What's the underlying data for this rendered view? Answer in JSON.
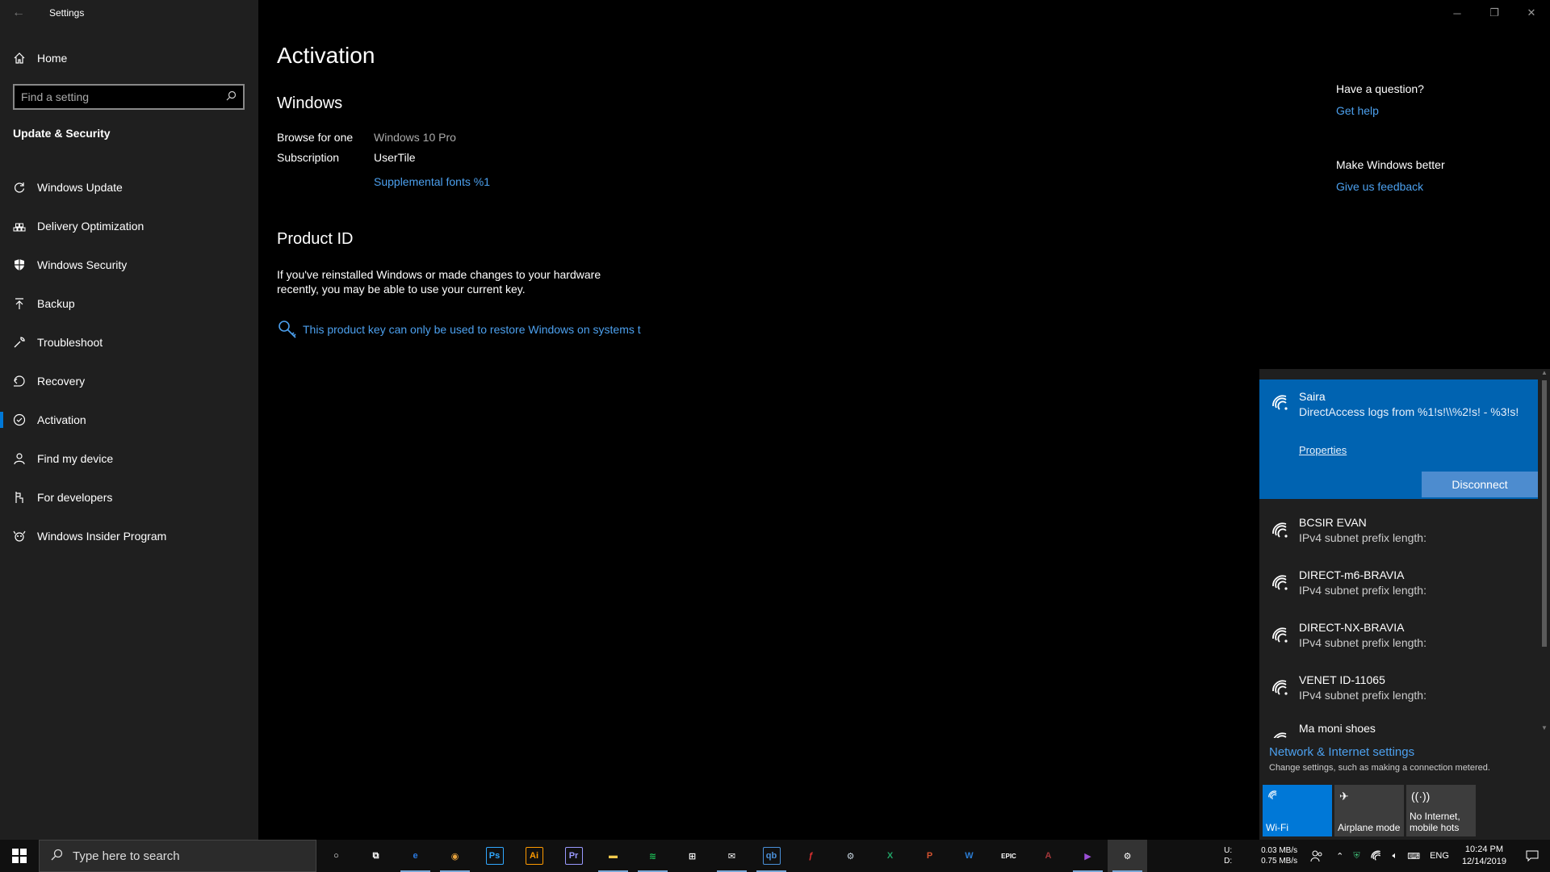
{
  "window": {
    "title": "Settings",
    "controls": {
      "minimize": "─",
      "restore": "❐",
      "close": "✕"
    }
  },
  "sidebar": {
    "home": "Home",
    "search_placeholder": "Find a setting",
    "section": "Update & Security",
    "items": [
      {
        "label": "Windows Update",
        "icon": "refresh-icon"
      },
      {
        "label": "Delivery Optimization",
        "icon": "delivery-icon"
      },
      {
        "label": "Windows Security",
        "icon": "shield-icon"
      },
      {
        "label": "Backup",
        "icon": "backup-icon"
      },
      {
        "label": "Troubleshoot",
        "icon": "wrench-icon"
      },
      {
        "label": "Recovery",
        "icon": "recovery-icon"
      },
      {
        "label": "Activation",
        "icon": "check-circle-icon",
        "active": true
      },
      {
        "label": "Find my device",
        "icon": "person-pin-icon"
      },
      {
        "label": "For developers",
        "icon": "developer-icon"
      },
      {
        "label": "Windows Insider Program",
        "icon": "insider-icon"
      }
    ]
  },
  "main": {
    "title": "Activation",
    "windows_heading": "Windows",
    "edition_label": "Browse for one",
    "edition_value": "Windows 10 Pro",
    "subscription_label": "Subscription",
    "subscription_value": "UserTile",
    "supplemental_link": "Supplemental fonts %1",
    "product_id_heading": "Product ID",
    "product_id_text": "If you've reinstalled Windows or made changes to your hardware recently, you may be able to use your current key.",
    "key_link": "This product key can only be used to restore Windows on systems t"
  },
  "help_panel": {
    "question_heading": "Have a question?",
    "get_help": "Get help",
    "better_heading": "Make Windows better",
    "feedback": "Give us feedback"
  },
  "network_flyout": {
    "connected": {
      "name": "Saira",
      "status": "DirectAccess logs from %1!s!\\\\%2!s! - %3!s!",
      "properties": "Properties",
      "disconnect": "Disconnect"
    },
    "networks": [
      {
        "name": "BCSIR EVAN",
        "status": "IPv4 subnet prefix length:"
      },
      {
        "name": "DIRECT-m6-BRAVIA",
        "status": "IPv4 subnet prefix length:"
      },
      {
        "name": "DIRECT-NX-BRAVIA",
        "status": "IPv4 subnet prefix length:"
      },
      {
        "name": "VENET ID-11065",
        "status": "IPv4 subnet prefix length:"
      },
      {
        "name": "Ma moni shoes",
        "status": ""
      }
    ],
    "settings_link": "Network & Internet settings",
    "settings_sub": "Change settings, such as making a connection metered.",
    "tiles": [
      {
        "label": "Wi-Fi",
        "icon": "wifi-icon",
        "on": true
      },
      {
        "label": "Airplane mode",
        "icon": "airplane-icon",
        "on": false
      },
      {
        "label": "No Internet, mobile hots",
        "icon": "hotspot-icon",
        "on": false
      }
    ]
  },
  "taskbar": {
    "search_placeholder": "Type here to search",
    "apps": [
      {
        "name": "cortana",
        "glyph": "○",
        "color": "#ffffff"
      },
      {
        "name": "task-view",
        "glyph": "⧉",
        "color": "#ffffff"
      },
      {
        "name": "edge",
        "glyph": "e",
        "color": "#2a7ae2"
      },
      {
        "name": "chrome",
        "glyph": "◉",
        "color": "#e8a33d"
      },
      {
        "name": "photoshop",
        "glyph": "Ps",
        "color": "#31a8ff"
      },
      {
        "name": "illustrator",
        "glyph": "Ai",
        "color": "#ff9a00"
      },
      {
        "name": "premiere",
        "glyph": "Pr",
        "color": "#9999ff"
      },
      {
        "name": "file-explorer",
        "glyph": "▬",
        "color": "#f2c94c"
      },
      {
        "name": "spotify",
        "glyph": "≋",
        "color": "#1db954"
      },
      {
        "name": "store",
        "glyph": "⊞",
        "color": "#ffffff"
      },
      {
        "name": "mail",
        "glyph": "✉",
        "color": "#ffffff"
      },
      {
        "name": "qbittorrent",
        "glyph": "qb",
        "color": "#4a90d9"
      },
      {
        "name": "flash",
        "glyph": "ƒ",
        "color": "#e03131"
      },
      {
        "name": "steam",
        "glyph": "⚙",
        "color": "#c7d5e0"
      },
      {
        "name": "excel",
        "glyph": "X",
        "color": "#21a366"
      },
      {
        "name": "powerpoint",
        "glyph": "P",
        "color": "#d35230"
      },
      {
        "name": "word",
        "glyph": "W",
        "color": "#2b7cd3"
      },
      {
        "name": "epic",
        "glyph": "EPIC",
        "color": "#ffffff"
      },
      {
        "name": "access",
        "glyph": "A",
        "color": "#a4373a"
      },
      {
        "name": "visual-studio",
        "glyph": "▶",
        "color": "#9b4fd6"
      },
      {
        "name": "settings",
        "glyph": "⚙",
        "color": "#ffffff"
      }
    ],
    "tray": {
      "drive_u": "U:",
      "drive_d": "D:",
      "up_speed": "0.03 MB/s",
      "down_speed": "0.75 MB/s",
      "language": "ENG",
      "time": "10:24 PM",
      "date": "12/14/2019"
    }
  }
}
